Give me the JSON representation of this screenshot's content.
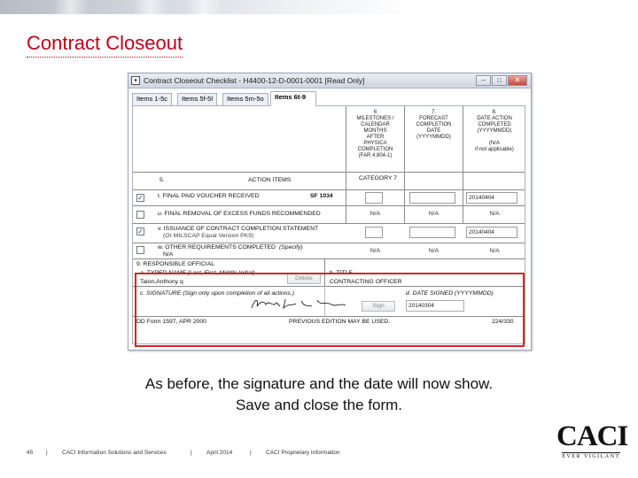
{
  "slide": {
    "title": "Contract Closeout",
    "caption_line1": "As before, the signature and the date will now show.",
    "caption_line2": "Save and close the form.",
    "accent_color": "#c0001b",
    "highlight_color": "#d8261f"
  },
  "window": {
    "title": "Contract Closeout Checklist - H4400-12-D-0001-0001 [Read Only]",
    "tabs": [
      "Items 1-5c",
      "Items 5f-5l",
      "Items 5m-5o",
      "Items 6t-9"
    ],
    "active_tab_index": 3,
    "buttons": [
      "minimize-icon",
      "maximize-icon",
      "close-icon"
    ]
  },
  "form": {
    "col6": "6\nMILESTONES /\nCALENDAR\nMONTHS\nAFTER\nPHYSICA\nCOMPLETION\n(FAR 4.804-1)",
    "col7": "7.\nFORECAST\nCOMPLETION\nDATE\n(YYYYMMDD)",
    "col8": "8.\nDATE ACTION\nCOMPLETED\n(YYYYMMDD)\n\n(N/A\nif not applicable)",
    "row5_label": "5.",
    "action_items_label": "ACTION ITEMS",
    "category_label": "CATEGORY 7",
    "items": [
      {
        "label": "t. FINAL PAID VOUCHER RECEIVED",
        "extra": "SF 1034",
        "checked": true,
        "c7": "",
        "c8": "20140404"
      },
      {
        "label": "u. FINAL REMOVAL OF EXCESS FUNDS RECOMMENDED",
        "extra": "",
        "checked": false,
        "c6": "N/A",
        "c7": "N/A",
        "c8": "N/A"
      },
      {
        "label": "v. ISSUANCE OF CONTRACT COMPLETION STATEMENT",
        "sub": "(Or MILSCAP Equal Version PK9)",
        "checked": true,
        "c7": "",
        "c8": "20140404"
      },
      {
        "label": "w. OTHER REQUIREMENTS COMPLETED",
        "sub_inline": "(Specify)",
        "sub": "N/A",
        "checked": false,
        "c6": "N/A",
        "c7": "N/A",
        "c8": "N/A"
      }
    ],
    "responsible_official": "9. RESPONSIBLE OFFICIAL",
    "typed_name_label": "a. TYPED NAME (Last, First, Middle Initial)",
    "typed_name_value": "Talon,Anthony q",
    "delete_button": "Delete",
    "title_label": "b. TITLE",
    "title_value": "CONTRACTING OFFICER",
    "signature_label": "c. SIGNATURE (Sign only upon completion of all actions.)",
    "sign_button": "Sign",
    "date_signed_label": "d. DATE SIGNED (YYYYMMDD)",
    "date_signed_value": "20140304",
    "form_number": "DD Form 1597, APR 2000",
    "edition_note": "PREVIOUS EDITION MAY BE USED.",
    "page_code": "224/330"
  },
  "footer": {
    "page_number": "45",
    "company": "CACI Information Solutions and Services",
    "date": "April 2014",
    "proprietary": "CACI Proprietary Information",
    "separator": "|"
  },
  "logo": {
    "wordmark": "CACI",
    "tagline": "EVER VIGILANT"
  }
}
